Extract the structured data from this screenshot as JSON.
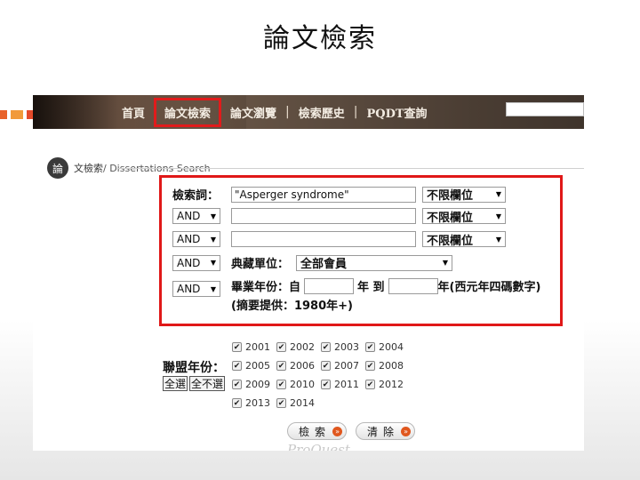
{
  "slide": {
    "title": "論文檢索"
  },
  "nav": {
    "items": [
      {
        "label": "首頁",
        "active": false
      },
      {
        "label": "論文檢索",
        "active": true
      },
      {
        "label": "論文瀏覽",
        "active": false
      },
      {
        "label": "檢索歷史",
        "active": false
      },
      {
        "label": "PQDT查詢",
        "active": false
      }
    ],
    "separator": "|"
  },
  "breadcrumb": {
    "badge": "論",
    "current": "文檢索",
    "sub": " / Dissertations Search"
  },
  "search": {
    "keyword_label": "檢索詞：",
    "keyword_value": "\"Asperger syndrome\"",
    "field_option": "不限欄位",
    "bool_option": "AND",
    "institution_label": "典藏單位：",
    "institution_value": "全部會員",
    "grad_year_label": "畢業年份：自",
    "year_to": "年 到",
    "year_suffix": "年(西元年四碼數字)",
    "abstract_note": "(摘要提供：1980年+)"
  },
  "years": {
    "label": "聯盟年份：",
    "select_all": "全選",
    "select_none": "全不選",
    "items": [
      "2001",
      "2002",
      "2003",
      "2004",
      "2005",
      "2006",
      "2007",
      "2008",
      "2009",
      "2010",
      "2011",
      "2012",
      "2013",
      "2014"
    ]
  },
  "buttons": {
    "search": "檢索",
    "clear": "清除",
    "go_icon": "»"
  },
  "footer": {
    "logo_text": "ProQuest"
  },
  "colors": {
    "highlight": "#e01818",
    "accent_orange": "#e0571e"
  }
}
